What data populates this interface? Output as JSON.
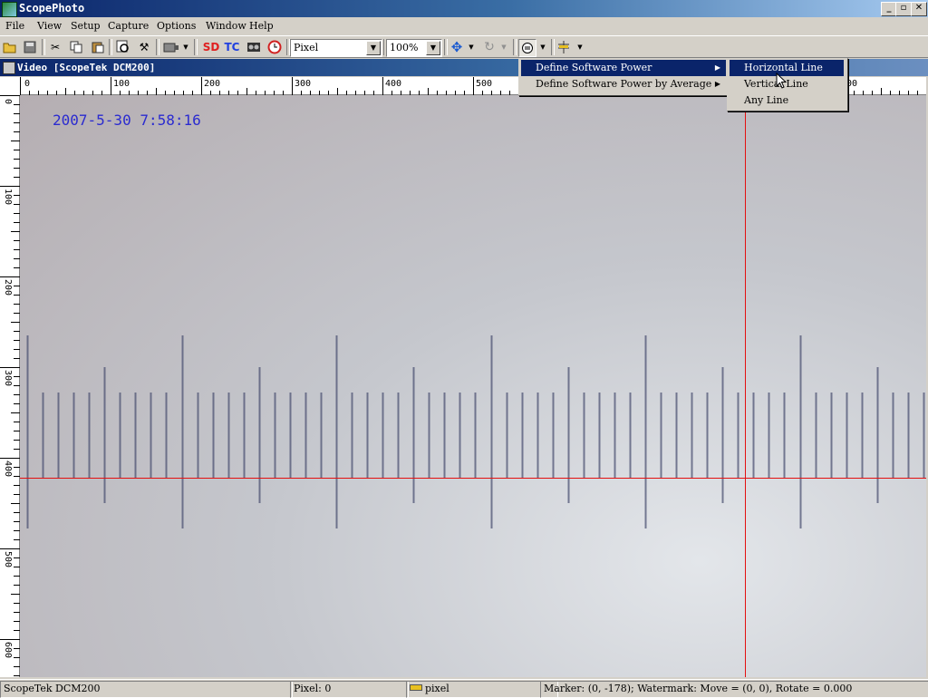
{
  "window": {
    "title": "ScopePhoto",
    "minimize": "_",
    "restore": "▫",
    "close": "✕"
  },
  "menubar": [
    "File",
    "View",
    "Setup",
    "Capture",
    "Options",
    "Window",
    "Help"
  ],
  "toolbar": {
    "sd_label": "SD",
    "tc_label": "TC",
    "unit_combo": "Pixel",
    "zoom_combo": "100%"
  },
  "child_window": {
    "title": "Video [ScopeTek DCM200]"
  },
  "ruler": {
    "horizontal": [
      "0",
      "100",
      "200",
      "300",
      "400",
      "500",
      "00"
    ],
    "vertical": [
      "0",
      "100",
      "200",
      "300",
      "400",
      "500",
      "600"
    ]
  },
  "video": {
    "timestamp": "2007-5-30 7:58:16"
  },
  "context_menu": {
    "items": [
      "Define Software Power",
      "Define Software Power by Average"
    ],
    "submenu": [
      "Horizontal Line",
      "Vertical Line",
      "Any Line"
    ]
  },
  "statusbar": {
    "device": "ScopeTek DCM200",
    "pixel": "Pixel: 0",
    "unit": "pixel",
    "marker": "Marker: (0, -178); Watermark: Move = (0, 0), Rotate = 0.000"
  },
  "colors": {
    "crosshair": "#e31010",
    "timestamp": "#2b2bd0",
    "selection": "#0a246a"
  }
}
